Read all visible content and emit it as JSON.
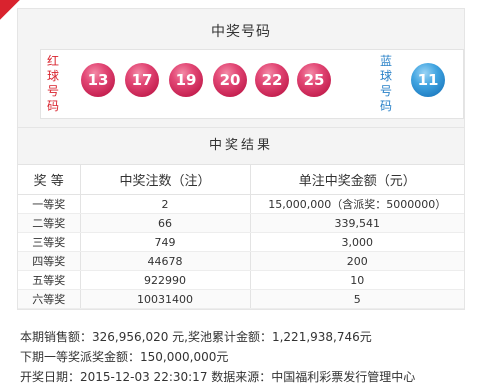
{
  "numbers_section": {
    "title": "中奖号码",
    "red_label": [
      "红",
      "球",
      "号",
      "码"
    ],
    "blue_label": [
      "蓝",
      "球",
      "号",
      "码"
    ],
    "red_balls": [
      "13",
      "17",
      "19",
      "20",
      "22",
      "25"
    ],
    "blue_ball": "11",
    "colors": {
      "red_ball": "#d9234f",
      "blue_ball": "#2a82c8"
    }
  },
  "results_section": {
    "title": "中奖结果",
    "headers": [
      "奖 等",
      "中奖注数（注）",
      "单注中奖金额（元）"
    ],
    "rows": [
      {
        "level": "一等奖",
        "count": "2",
        "amount": "15,000,000（含派奖：5000000）"
      },
      {
        "level": "二等奖",
        "count": "66",
        "amount": "339,541"
      },
      {
        "level": "三等奖",
        "count": "749",
        "amount": "3,000"
      },
      {
        "level": "四等奖",
        "count": "44678",
        "amount": "200"
      },
      {
        "level": "五等奖",
        "count": "922990",
        "amount": "10"
      },
      {
        "level": "六等奖",
        "count": "10031400",
        "amount": "5"
      }
    ]
  },
  "info": {
    "sales_line": "本期销售额：326,956,020 元,奖池累计金额：1,221,938,746元",
    "next_bonus_line": "下期一等奖派奖金额：150,000,000元",
    "draw_date_line": "开奖日期：2015-12-03 22:30:17 数据来源：中国福利彩票发行管理中心"
  }
}
